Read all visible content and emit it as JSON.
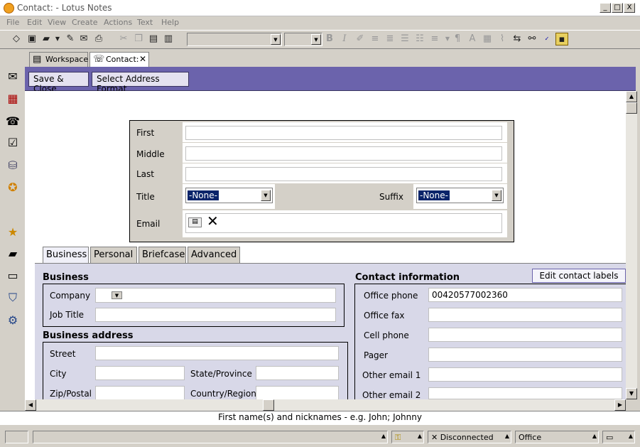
{
  "window": {
    "title": "Contact: - Lotus Notes",
    "min": "_",
    "max": "□",
    "close": "X"
  },
  "menu": [
    "File",
    "Edit",
    "View",
    "Create",
    "Actions",
    "Text",
    "Help"
  ],
  "tabs": [
    {
      "label": "Workspace",
      "close": ""
    },
    {
      "label": "Contact:",
      "close": "✕"
    }
  ],
  "actions": {
    "save_close": "Save & Close",
    "select_address": "Select Address Format"
  },
  "name": {
    "first_label": "First",
    "first_value": "",
    "middle_label": "Middle",
    "middle_value": "",
    "last_label": "Last",
    "last_value": "",
    "title_label": "Title",
    "title_value": "-None-",
    "suffix_label": "Suffix",
    "suffix_value": "-None-",
    "email_label": "Email"
  },
  "section_tabs": [
    "Business",
    "Personal",
    "Briefcase",
    "Advanced"
  ],
  "business": {
    "heading": "Business",
    "company_label": "Company",
    "company_value": "",
    "jobtitle_label": "Job Title",
    "jobtitle_value": ""
  },
  "address": {
    "heading": "Business address",
    "street_label": "Street",
    "city_label": "City",
    "state_label": "State/Province",
    "zip_label": "Zip/Postal",
    "country_label": "Country/Region"
  },
  "contact": {
    "heading": "Contact information",
    "edit_labels": "Edit contact labels",
    "rows": [
      {
        "label": "Office phone",
        "value": "00420577002360"
      },
      {
        "label": "Office fax",
        "value": ""
      },
      {
        "label": "Cell phone",
        "value": ""
      },
      {
        "label": "Pager",
        "value": ""
      },
      {
        "label": "Other email 1",
        "value": ""
      },
      {
        "label": "Other email 2",
        "value": ""
      }
    ]
  },
  "hint": "First name(s) and nicknames - e.g. John; Johnny",
  "statusbar": {
    "connection": "Disconnected",
    "location": "Office"
  },
  "colors": {
    "action_bar": "#6b63ac",
    "tab_panel": "#d8d8e8",
    "selection": "#0a246a"
  }
}
